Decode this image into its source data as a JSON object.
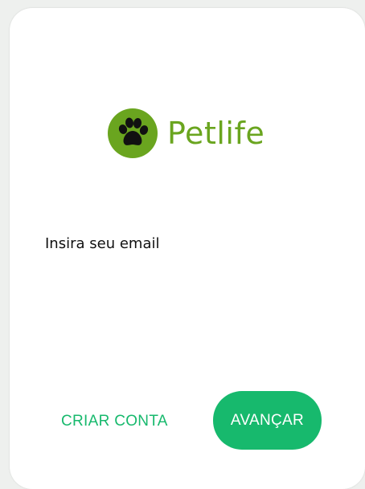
{
  "app": {
    "logo_text": "Petlife",
    "logo_icon": "paw-icon"
  },
  "form": {
    "email_label": "Insira seu email"
  },
  "actions": {
    "create_account_label": "CRIAR CONTA",
    "next_label": "AVANÇAR"
  },
  "colors": {
    "brand_green": "#6aa51f",
    "accent_green": "#17b96d",
    "text_dark": "#111111"
  }
}
